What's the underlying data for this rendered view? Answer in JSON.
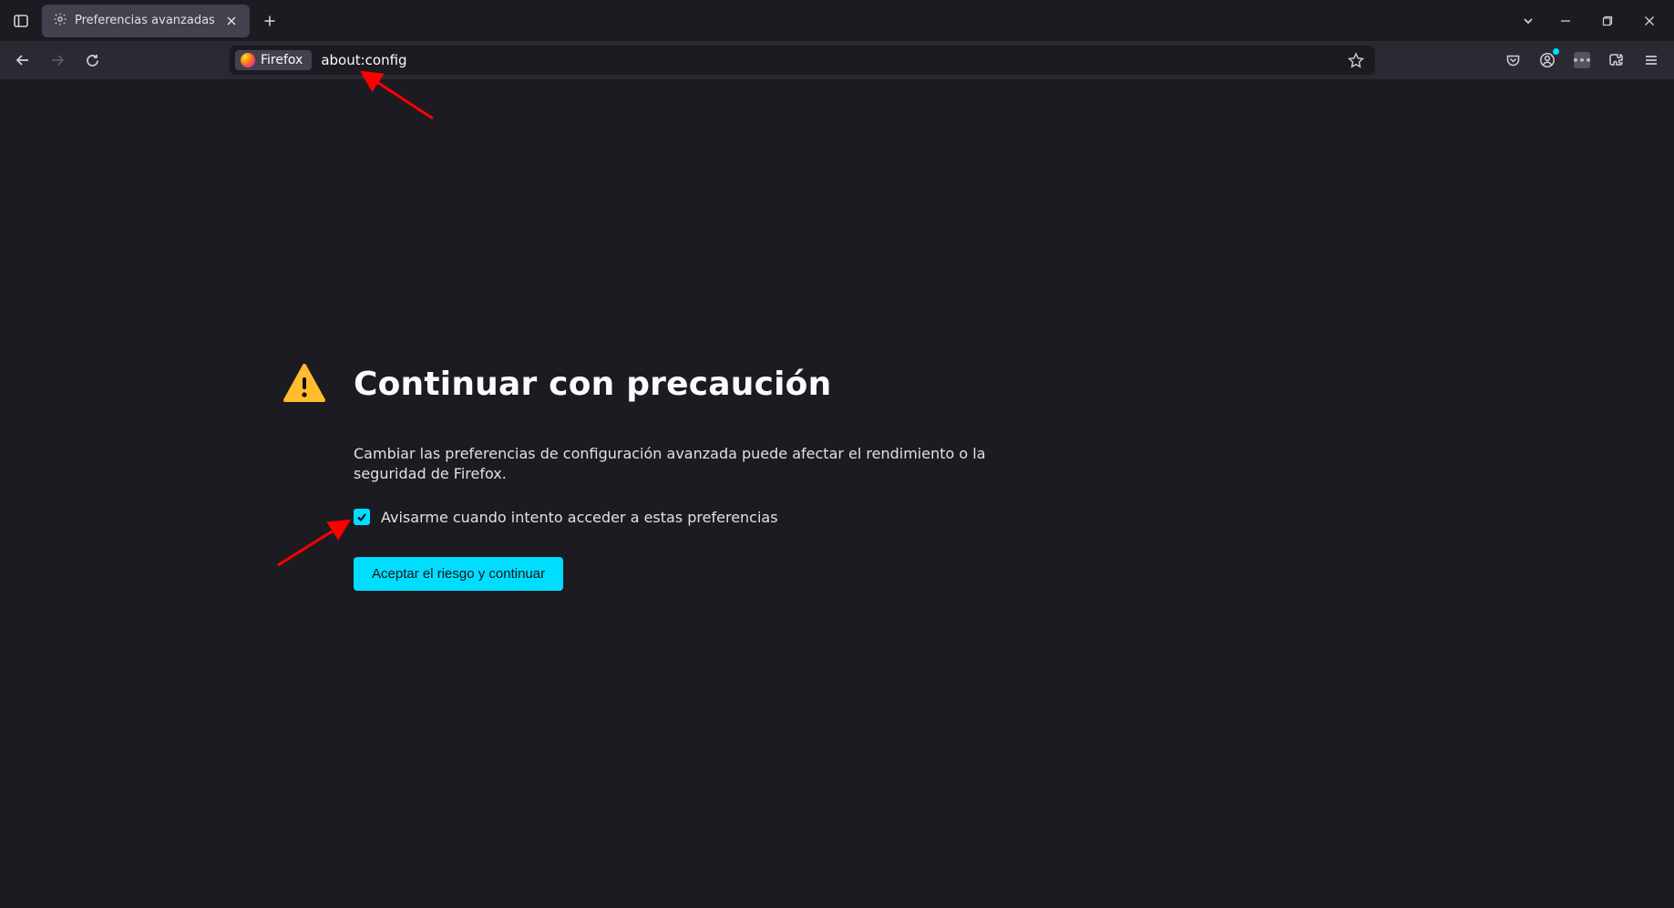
{
  "tab": {
    "title": "Preferencias avanzadas"
  },
  "urlbar": {
    "identity_label": "Firefox",
    "url": "about:config"
  },
  "warning": {
    "title": "Continuar con precaución",
    "description": "Cambiar las preferencias de configuración avanzada puede afectar el rendimiento o la seguridad de Firefox.",
    "checkbox_label": "Avisarme cuando intento acceder a estas preferencias",
    "checkbox_checked": true,
    "accept_button": "Aceptar el riesgo y continuar"
  },
  "colors": {
    "accent": "#00ddff",
    "warning_triangle": "#ffbd2e"
  }
}
